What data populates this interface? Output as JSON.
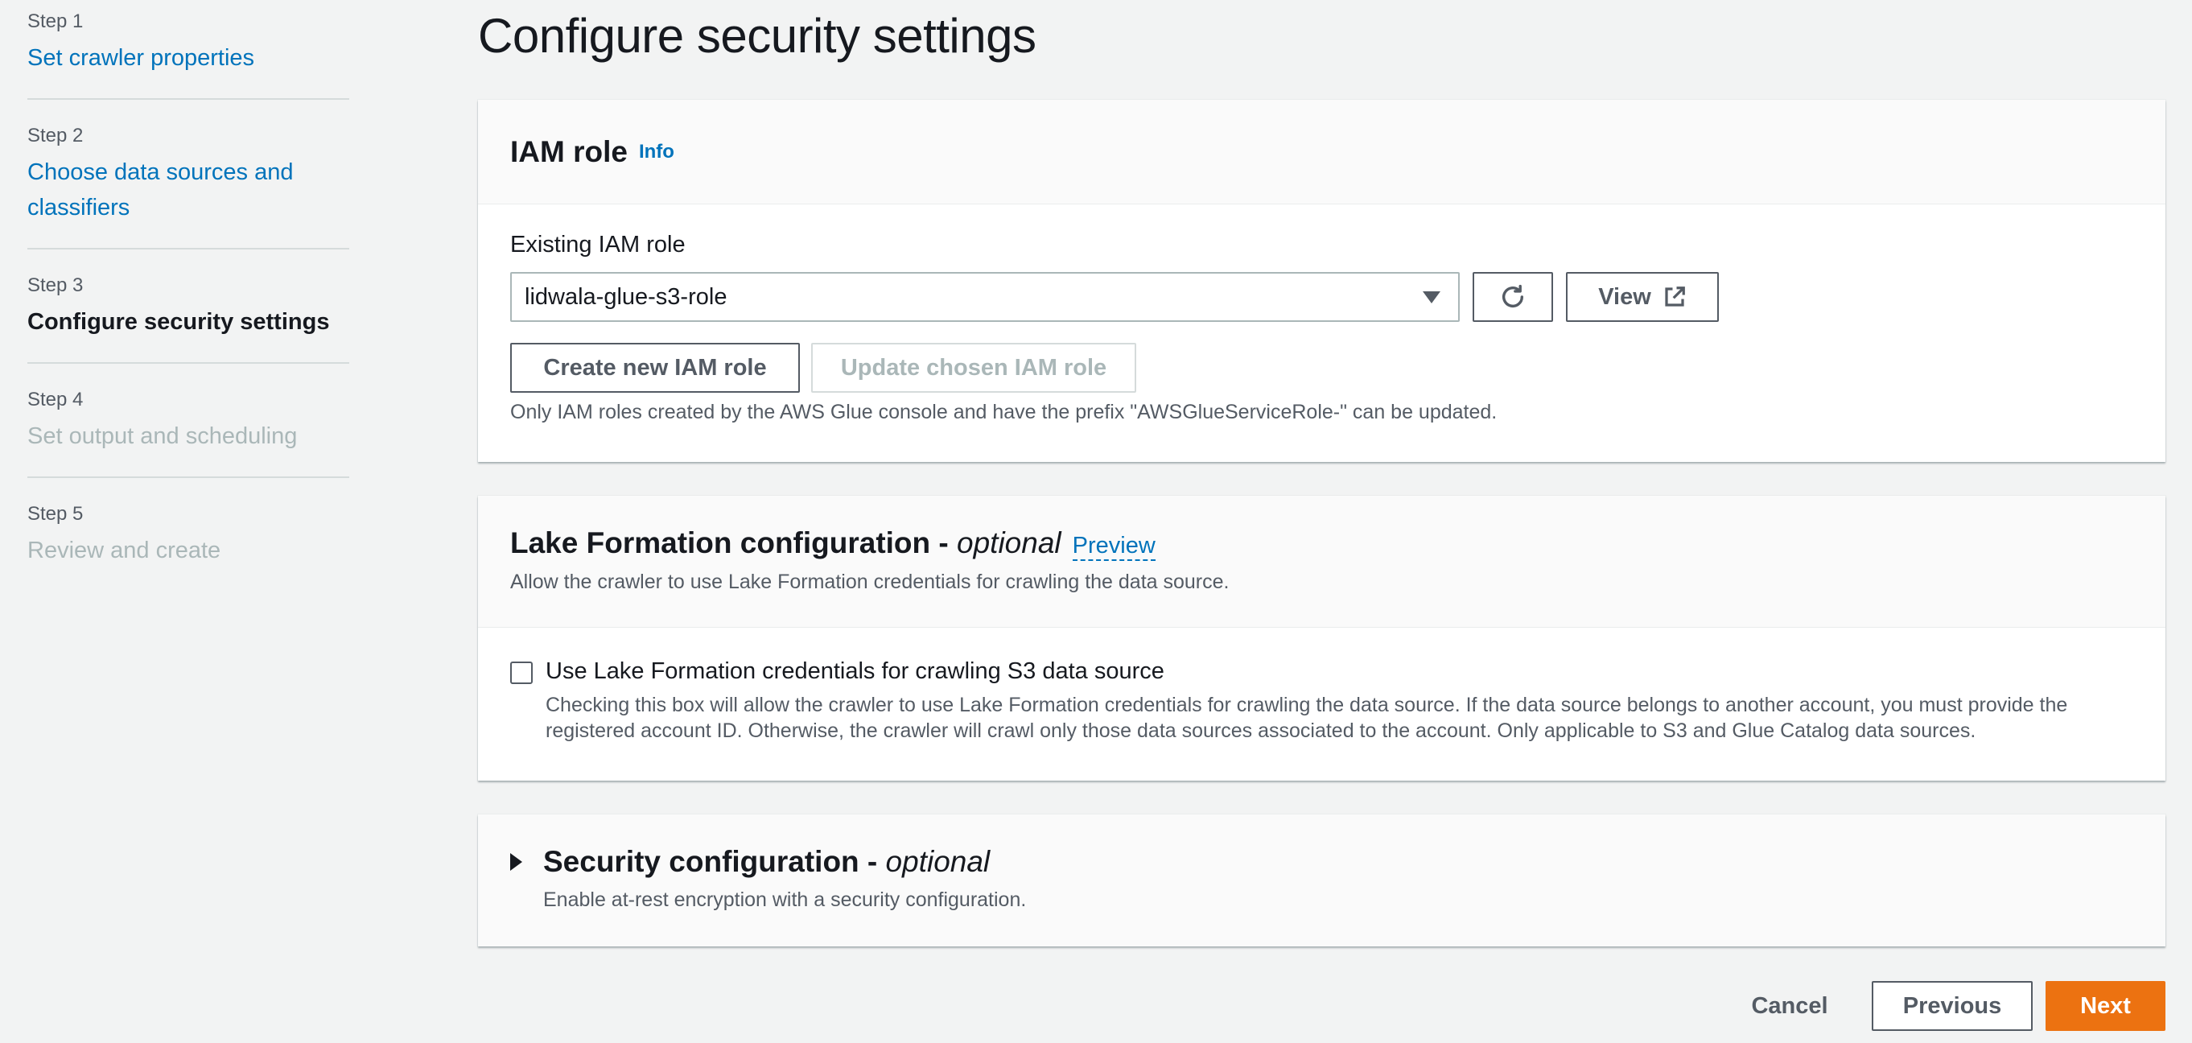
{
  "steps": [
    {
      "num": "Step 1",
      "title": "Set crawler properties",
      "state": "link"
    },
    {
      "num": "Step 2",
      "title_line1": "Choose data sources and",
      "title_line2": "classifiers",
      "state": "link"
    },
    {
      "num": "Step 3",
      "title": "Configure security settings",
      "state": "current"
    },
    {
      "num": "Step 4",
      "title": "Set output and scheduling",
      "state": "disabled"
    },
    {
      "num": "Step 5",
      "title": "Review and create",
      "state": "disabled"
    }
  ],
  "page_title": "Configure security settings",
  "iam": {
    "title": "IAM role",
    "info": "Info",
    "field_label": "Existing IAM role",
    "selected_role": "lidwala-glue-s3-role",
    "view_label": "View",
    "create_label": "Create new IAM role",
    "update_label": "Update chosen IAM role",
    "note": "Only IAM roles created by the AWS Glue console and have the prefix \"AWSGlueServiceRole-\" can be updated."
  },
  "lake": {
    "title": "Lake Formation configuration - ",
    "title_optional": "optional",
    "preview": "Preview",
    "description": "Allow the crawler to use Lake Formation credentials for crawling the data source.",
    "checkbox_label": "Use Lake Formation credentials for crawling S3 data source",
    "checkbox_desc_line1": "Checking this box will allow the crawler to use Lake Formation credentials for crawling the data source. If the data source belongs to another account, you must provide the",
    "checkbox_desc_line2": "registered account ID. Otherwise, the crawler will crawl only those data sources associated to the account. Only applicable to S3 and Glue Catalog data sources."
  },
  "security": {
    "title": "Security configuration - ",
    "title_optional": "optional",
    "description": "Enable at-rest encryption with a security configuration."
  },
  "footer": {
    "cancel": "Cancel",
    "previous": "Previous",
    "next": "Next"
  },
  "colors": {
    "link": "#0073bb",
    "primary": "#ec7211",
    "background": "#f2f3f3"
  }
}
